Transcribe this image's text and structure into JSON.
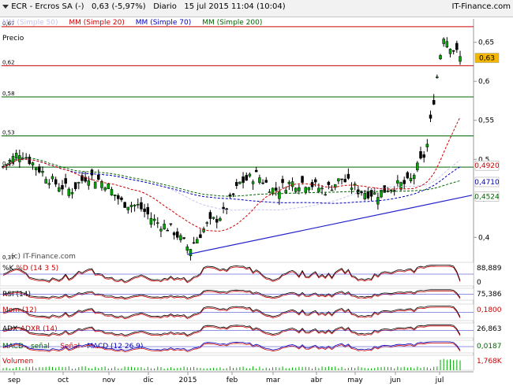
{
  "header": {
    "ticker": "ECR - Ercros SA (-)",
    "quote": "0,63 (-5,97%)",
    "period": "Diario",
    "timestamp": "15 jul 2015 11:04 (10:04)",
    "brand": "IT-Finance.com"
  },
  "main_panel": {
    "label": "Precio",
    "legend": [
      {
        "text": "MM (Simple 50)",
        "color": "#c4c4ee"
      },
      {
        "text": "MM (Simple 20)",
        "color": "#cc0000"
      },
      {
        "text": "MM (Simple 70)",
        "color": "#0000bb"
      },
      {
        "text": "MM (Simple 200)",
        "color": "#006600"
      }
    ],
    "watermark": "(c) IT-Finance.com",
    "left_levels": [
      "0,67",
      "0,62",
      "0,58",
      "0,53",
      "0,49",
      "0,37"
    ],
    "right_ticks": [
      "0,65",
      "0,6",
      "0,55",
      "0,5",
      "0,45",
      "0,4"
    ],
    "right_badges": [
      {
        "text": "0,63",
        "value": 0.63,
        "bg": "#f3b700",
        "fg": "#000000"
      },
      {
        "text": "0,4920",
        "value": 0.492,
        "bg": "#ffffff",
        "fg": "#cc0000"
      },
      {
        "text": "0,4710",
        "value": 0.471,
        "bg": "#ffffff",
        "fg": "#0000bb"
      },
      {
        "text": "0,4524",
        "value": 0.4524,
        "bg": "#ffffff",
        "fg": "#006600"
      }
    ]
  },
  "sub_panels": [
    {
      "id": "stoch",
      "legend": [
        {
          "text": "%K",
          "color": "#000000"
        },
        {
          "text": "%D (14 3 5)",
          "color": "#cc0000"
        }
      ],
      "right_labels": [
        {
          "text": "88,889",
          "color": "#000000"
        },
        {
          "text": "0",
          "color": "#000000"
        }
      ]
    },
    {
      "id": "rsi",
      "legend": [
        {
          "text": "RSI (14)",
          "color": "#000000"
        }
      ],
      "right_labels": [
        {
          "text": "75,386",
          "color": "#000000"
        }
      ]
    },
    {
      "id": "mom",
      "legend": [
        {
          "text": "Mom (12)",
          "color": "#cc0000"
        }
      ],
      "right_labels": [
        {
          "text": "0,1800",
          "color": "#cc0000"
        }
      ]
    },
    {
      "id": "adx",
      "legend": [
        {
          "text": "ADX",
          "color": "#000000"
        },
        {
          "text": "ADXR (14)",
          "color": "#cc0000"
        }
      ],
      "right_labels": [
        {
          "text": "26,863",
          "color": "#000000"
        }
      ]
    },
    {
      "id": "macd",
      "legend": [
        {
          "text": "MACD-, señal",
          "color": "#006600"
        },
        {
          "text": "Señal",
          "color": "#cc0000"
        },
        {
          "text": "MACD (12 26 9)",
          "color": "#0000bb"
        }
      ],
      "right_labels": [
        {
          "text": "0,0187",
          "color": "#006600"
        }
      ]
    },
    {
      "id": "vol",
      "legend": [
        {
          "text": "Volumen",
          "color": "#cc0000"
        }
      ],
      "right_labels": [
        {
          "text": "1,768K",
          "color": "#cc0000"
        }
      ]
    }
  ],
  "chart_data": {
    "type": "candlestick",
    "price_axis": {
      "ylim": [
        0.37,
        0.68
      ],
      "ticks": [
        0.4,
        0.45,
        0.5,
        0.55,
        0.6,
        0.65
      ]
    },
    "x_axis": {
      "labels": [
        "sep",
        "oct",
        "nov",
        "dic",
        "2015",
        "feb",
        "mar",
        "abr",
        "may",
        "jun",
        "jul"
      ]
    },
    "horizontal_levels": [
      {
        "value": 0.67,
        "color": "#cc0000"
      },
      {
        "value": 0.62,
        "color": "#cc0000"
      },
      {
        "value": 0.58,
        "color": "#006600"
      },
      {
        "value": 0.53,
        "color": "#006600"
      },
      {
        "value": 0.49,
        "color": "#006600"
      }
    ],
    "trendline": {
      "from": {
        "date": "2014-12-29",
        "value": 0.378
      },
      "to": {
        "date": "2015-07-15",
        "value": 0.454
      }
    },
    "close_profile": [
      [
        "sep",
        0.49
      ],
      [
        "sep",
        0.51
      ],
      [
        "oct",
        0.49
      ],
      [
        "oct",
        0.47
      ],
      [
        "oct",
        0.46
      ],
      [
        "nov",
        0.48
      ],
      [
        "nov",
        0.47
      ],
      [
        "nov",
        0.445
      ],
      [
        "dic",
        0.44
      ],
      [
        "dic",
        0.42
      ],
      [
        "dic",
        0.41
      ],
      [
        "2015",
        0.385
      ],
      [
        "2015",
        0.415
      ],
      [
        "feb",
        0.43
      ],
      [
        "feb",
        0.47
      ],
      [
        "mar",
        0.48
      ],
      [
        "mar",
        0.46
      ],
      [
        "mar",
        0.47
      ],
      [
        "abr",
        0.47
      ],
      [
        "abr",
        0.46
      ],
      [
        "may",
        0.475
      ],
      [
        "may",
        0.46
      ],
      [
        "jun",
        0.455
      ],
      [
        "jun",
        0.465
      ],
      [
        "jul",
        0.47
      ],
      [
        "jul",
        0.51
      ],
      [
        "jul",
        0.66
      ],
      [
        "jul",
        0.63
      ]
    ],
    "last": 0.63,
    "indicators": {
      "stoch_k_last": 88.889,
      "rsi_last": 75.386,
      "momentum_last": 0.18,
      "adx_last": 26.863,
      "macd_last": 0.0187,
      "volume_last": "1,768K"
    }
  }
}
